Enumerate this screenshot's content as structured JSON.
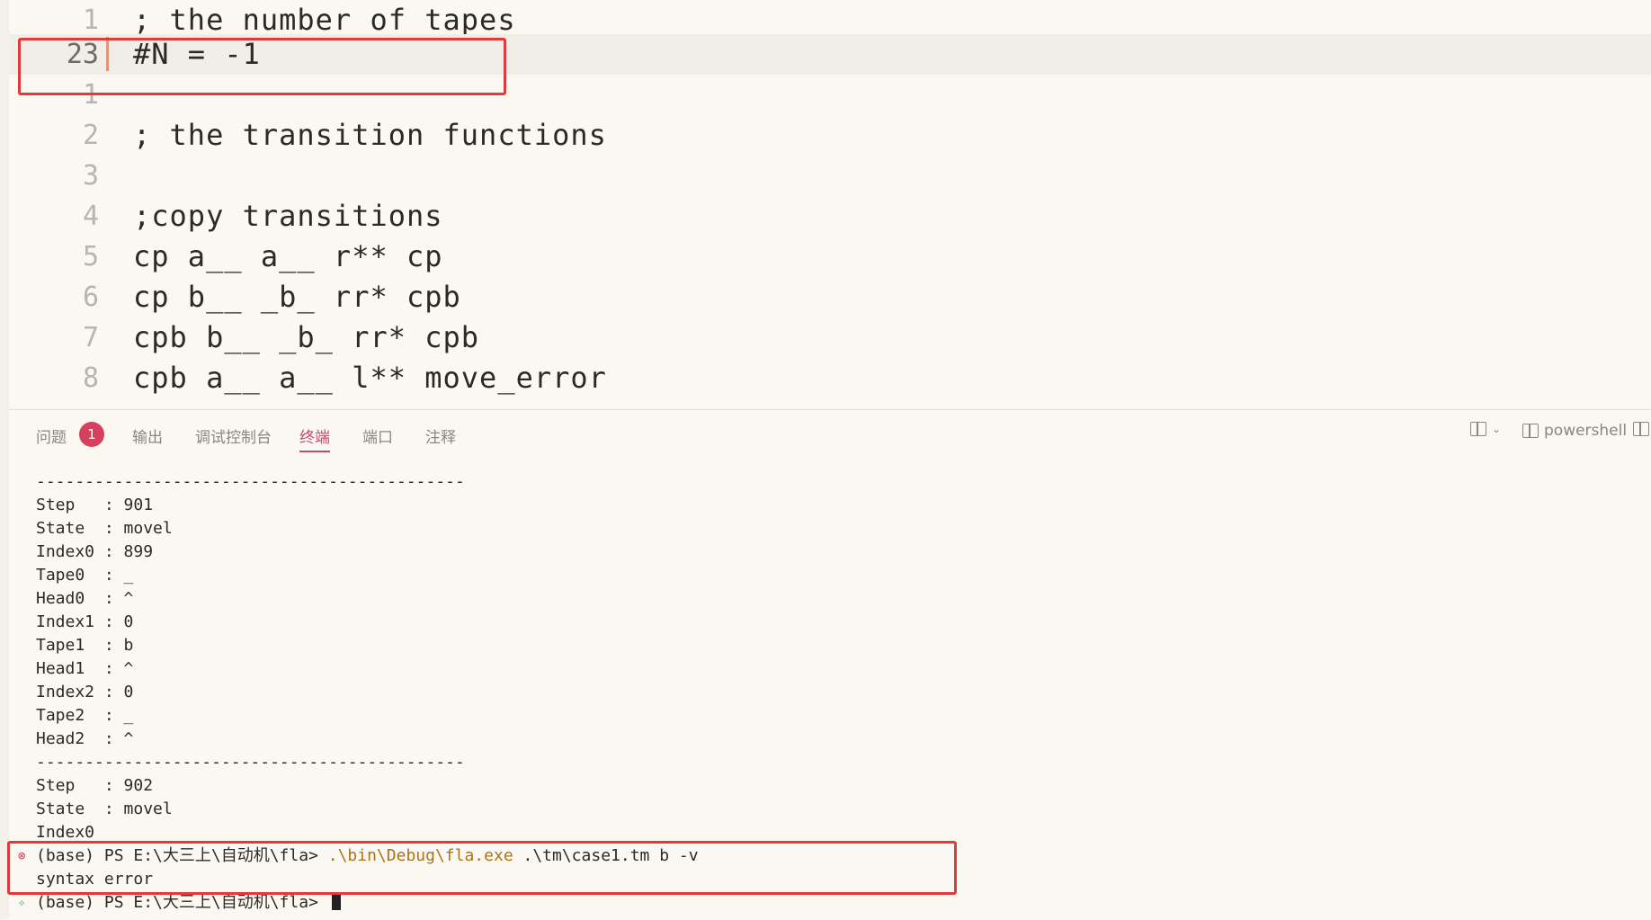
{
  "editor": {
    "lines": [
      {
        "num": "1",
        "text": "; the number of tapes"
      },
      {
        "num": "23",
        "text": "#N = -1"
      },
      {
        "num": "1",
        "text": ""
      },
      {
        "num": "2",
        "text": "; the transition functions"
      },
      {
        "num": "3",
        "text": ""
      },
      {
        "num": "4",
        "text": ";copy transitions"
      },
      {
        "num": "5",
        "text": "cp a__ a__ r** cp"
      },
      {
        "num": "6",
        "text": "cp b__ _b_ rr* cpb"
      },
      {
        "num": "7",
        "text": "cpb b__ _b_ rr* cpb"
      },
      {
        "num": "8",
        "text": "cpb a__ a__ l** move_error"
      }
    ]
  },
  "panel": {
    "tabs": [
      "问题",
      "输出",
      "调试控制台",
      "终端",
      "端口",
      "注释"
    ],
    "active_tab": "终端",
    "problems_count": "1",
    "shell_label": "powershell"
  },
  "terminal": {
    "lines": [
      "--------------------------------------------",
      "Step   : 901",
      "State  : movel",
      "Index0 : 899",
      "Tape0  : _",
      "Head0  : ^",
      "Index1 : 0",
      "Tape1  : b",
      "Head1  : ^",
      "Index2 : 0",
      "Tape2  : _",
      "Head2  : ^",
      "--------------------------------------------",
      "Step   : 902",
      "State  : movel",
      "Index0"
    ],
    "cmd_prompt": "(base) PS E:\\大三上\\自动机\\fla> ",
    "cmd_exe": ".\\bin\\Debug\\fla.exe",
    "cmd_args": " .\\tm\\case1.tm b -v",
    "error_text": "syntax error",
    "last_prompt": "(base) PS E:\\大三上\\自动机\\fla> "
  },
  "colors": {
    "accent": "#c24b6c",
    "highlight_box": "#e03a3a",
    "badge": "#d6405f"
  }
}
